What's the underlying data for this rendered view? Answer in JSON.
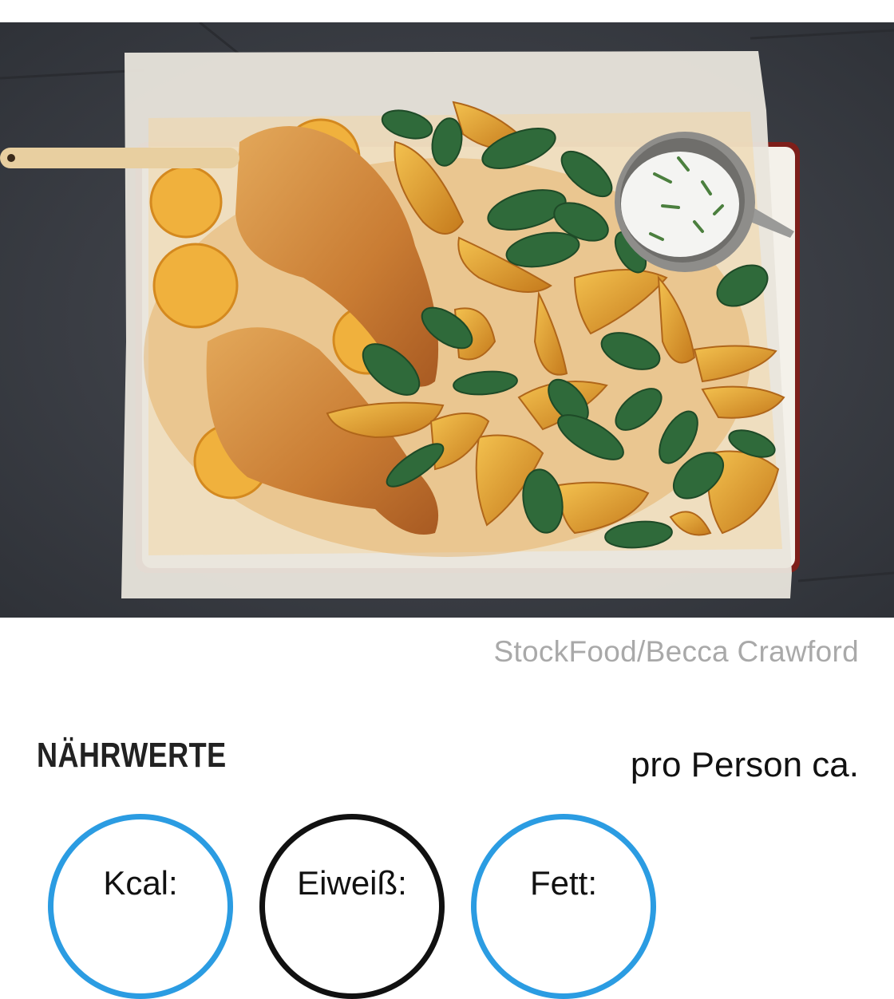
{
  "image": {
    "credit": "StockFood/Becca Crawford"
  },
  "nutrition": {
    "title": "NÄHRWERTE",
    "per_serving": "pro Person ca.",
    "items": [
      {
        "label": "Kcal:",
        "color": "#2b9ce2"
      },
      {
        "label": "Eiweiß:",
        "color": "#111111"
      },
      {
        "label": "Fett:",
        "color": "#2b9ce2"
      }
    ]
  }
}
